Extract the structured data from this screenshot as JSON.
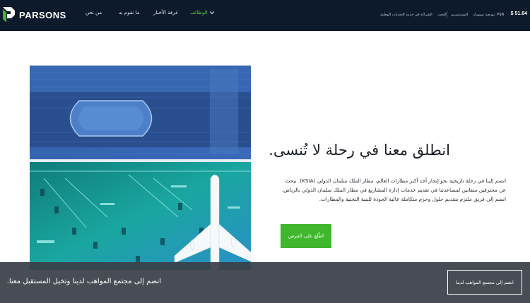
{
  "brand": {
    "name": "PARSONS"
  },
  "nav": {
    "careers": "الوظائف",
    "newsroom": "غرفة الأخبار",
    "what_we_do": "ما نقوم به",
    "about": "من نحن"
  },
  "utility": {
    "strategy": "الشراكة في خدمة التحديات الوطنية",
    "search": "البحث",
    "investors": "المستثمرين",
    "stock_label": "بورصة نيويورك: PSN",
    "stock_price": "$ 51.64"
  },
  "hero": {
    "headline": "انطلق معنا في رحلة لا تُنسى.",
    "body": "انضم إلينا في رحلة تاريخية نحو إنجاز أحد أكبر مطارات العالم، مطار الملك سلمان الدولي (KSIA). نبحث عن محترفين متفانين لمساعدتنا في تقديم خدمات إدارة المشاريع في مطار الملك سلمان الدولي بالرياض. انضم إلى فريق ملتزم بتقديم حلول وحزم متكاملة عالية الجودة للبنية التحتية والمطارات.",
    "cta": "اطّلع على الفرص"
  },
  "banner": {
    "text": "انضم إلى مجتمع المواهب لدينا وتخيل المستقبل معنا.",
    "button": "انضم إلى مجتمع المواهب لدينا"
  },
  "colors": {
    "header_bg": "#0d1a2b",
    "accent_green": "#3fb62c",
    "nav_active": "#57c93b",
    "banner_bg": "#3a4048"
  },
  "icons": [
    "parsons-logo-icon",
    "chevron-down-icon"
  ]
}
